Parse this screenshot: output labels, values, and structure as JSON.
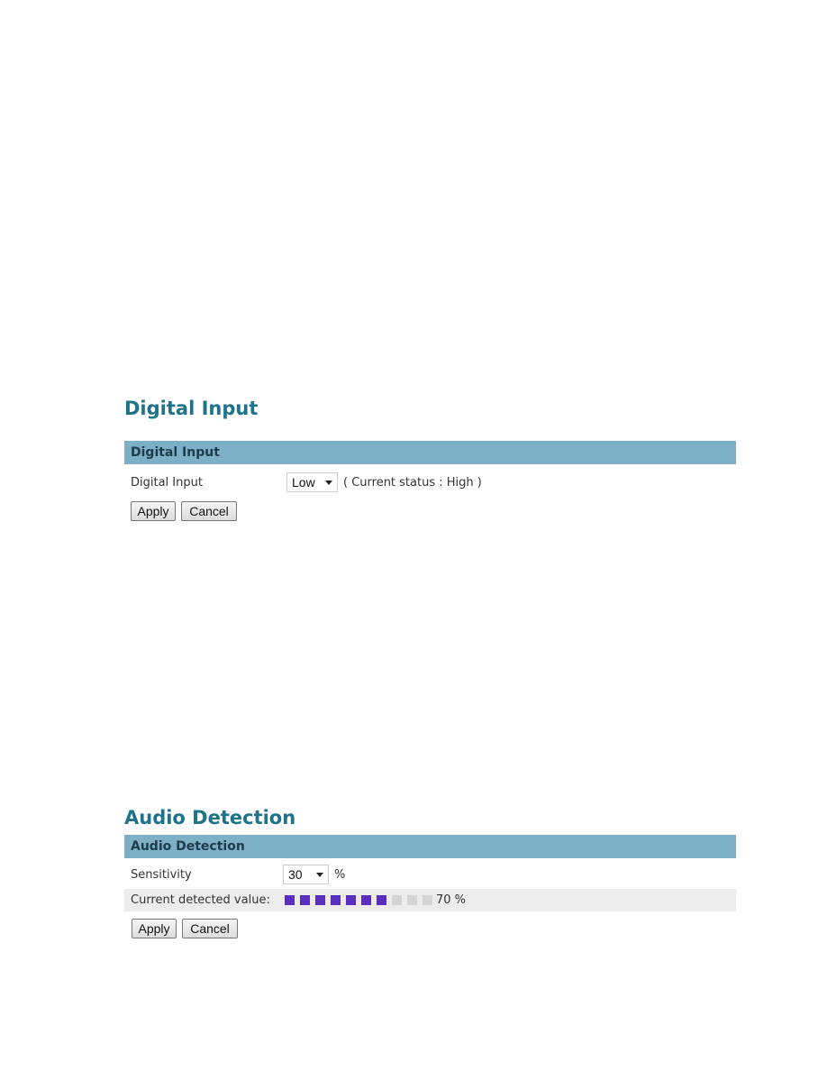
{
  "digital_input": {
    "title": "Digital Input",
    "section_header": "Digital Input",
    "field_label": "Digital Input",
    "select_value": "Low",
    "current_status": "( Current status : High )",
    "apply_label": "Apply",
    "cancel_label": "Cancel"
  },
  "audio_detection": {
    "title": "Audio Detection",
    "section_header": "Audio Detection",
    "sensitivity_label": "Sensitivity",
    "sensitivity_value": "30",
    "sensitivity_unit": "%",
    "detected_label": "Current detected value:",
    "detected_value_percent": 70,
    "detected_value_text": "70 %",
    "level_segments_total": 10,
    "level_segments_filled": 7,
    "colors": {
      "filled": "#5a2fbf",
      "empty": "#d4d4d4"
    },
    "apply_label": "Apply",
    "cancel_label": "Cancel"
  },
  "colors": {
    "title": "#1d7388",
    "header_bar": "#7db0c7"
  }
}
